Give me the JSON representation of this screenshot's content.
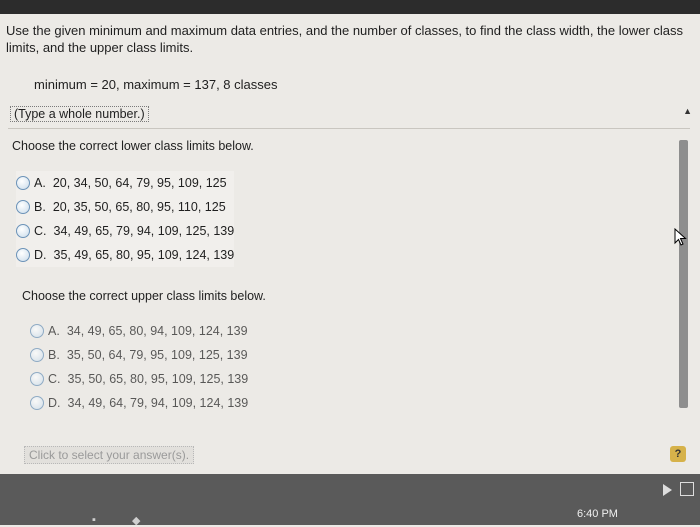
{
  "question": {
    "text": "Use the given minimum and maximum data entries, and the number of classes, to find the class width, the lower class limits, and the upper class limits.",
    "given": "minimum = 20, maximum = 137, 8 classes",
    "type_hint": "(Type a whole number.)"
  },
  "lower": {
    "prompt": "Choose the correct lower class limits below.",
    "options": [
      {
        "letter": "A.",
        "value": "20, 34, 50, 64, 79, 95, 109, 125"
      },
      {
        "letter": "B.",
        "value": "20, 35, 50, 65, 80, 95, 110, 125"
      },
      {
        "letter": "C.",
        "value": "34, 49, 65, 79, 94, 109, 125, 139"
      },
      {
        "letter": "D.",
        "value": "35, 49, 65, 80, 95, 109, 124, 139"
      }
    ]
  },
  "upper": {
    "prompt": "Choose the correct upper class limits below.",
    "options": [
      {
        "letter": "A.",
        "value": "34, 49, 65, 80, 94, 109, 124, 139"
      },
      {
        "letter": "B.",
        "value": "35, 50, 64, 79, 95, 109, 125, 139"
      },
      {
        "letter": "C.",
        "value": "35, 50, 65, 80, 95, 109, 125, 139"
      },
      {
        "letter": "D.",
        "value": "34, 49, 64, 79, 94, 109, 124, 139"
      }
    ]
  },
  "footer": {
    "click_select": "Click to select your answer(s).",
    "help": "?"
  },
  "taskbar": {
    "clock": "6:40 PM"
  },
  "colors": {
    "radio_border": "#6c93b8",
    "help_button": "#d6b24a",
    "taskbar": "#5a5a5a"
  }
}
